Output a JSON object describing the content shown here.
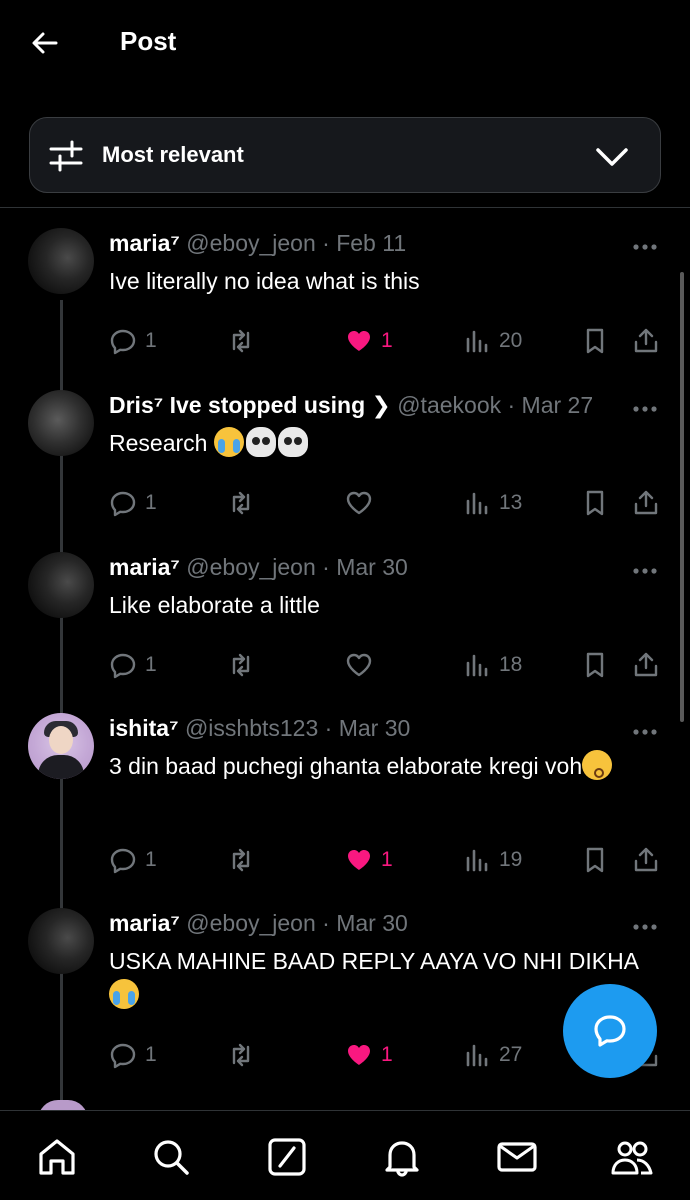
{
  "header": {
    "title": "Post"
  },
  "sort": {
    "label": "Most relevant"
  },
  "replies": [
    {
      "name": "maria⁷",
      "handle": "@eboy_jeon",
      "date": "· Feb 11",
      "text": "Ive literally no idea what is this",
      "emojis": [],
      "replies": "1",
      "retweets": "",
      "likes": "1",
      "liked": true,
      "views": "20"
    },
    {
      "name": "Dris⁷ Ive stopped using ❯",
      "handle": "@taekook",
      "date": "· Mar 27",
      "text": "Research ",
      "emojis": [
        "loudly-crying-face",
        "skull",
        "skull"
      ],
      "replies": "1",
      "retweets": "",
      "likes": "",
      "liked": false,
      "views": "13"
    },
    {
      "name": "maria⁷",
      "handle": "@eboy_jeon",
      "date": "· Mar 30",
      "text": "Like elaborate a little",
      "emojis": [],
      "replies": "1",
      "retweets": "",
      "likes": "",
      "liked": false,
      "views": "18"
    },
    {
      "name": "ishita⁷",
      "handle": "@isshbts123",
      "date": "· Mar 30",
      "text": "3 din baad puchegi ghanta elaborate kregi voh",
      "emojis": [
        "kissing-face"
      ],
      "replies": "1",
      "retweets": "",
      "likes": "1",
      "liked": true,
      "views": "19"
    },
    {
      "name": "maria⁷",
      "handle": "@eboy_jeon",
      "date": "· Mar 30",
      "text": "USKA MAHINE BAAD REPLY AAYA VO NHI DIKHA",
      "emojis": [
        "loudly-crying-face"
      ],
      "replies": "1",
      "retweets": "",
      "likes": "1",
      "liked": true,
      "views": "27"
    }
  ],
  "colors": {
    "background": "#000000",
    "accent": "#1d9bf0",
    "like": "#f91880",
    "muted": "#71767b"
  }
}
